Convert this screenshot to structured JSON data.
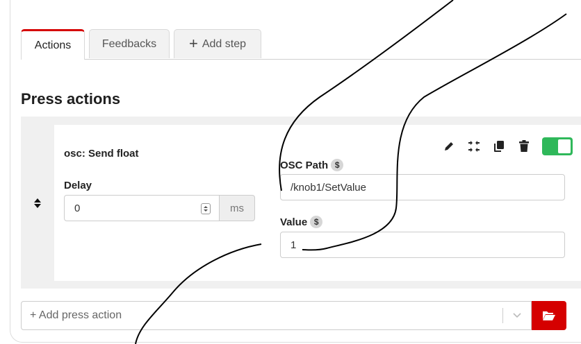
{
  "tabs": [
    {
      "label": "Actions",
      "active": true
    },
    {
      "label": "Feedbacks",
      "active": false
    },
    {
      "label": "Add step",
      "icon": "plus-icon",
      "active": false
    }
  ],
  "section": {
    "title": "Press actions"
  },
  "action": {
    "name": "osc: Send float",
    "delay": {
      "label": "Delay",
      "value": "0",
      "unit": "ms"
    },
    "osc_path": {
      "label": "OSC Path",
      "variable_badge": "$",
      "value": "/knob1/SetValue"
    },
    "value_field": {
      "label": "Value",
      "variable_badge": "$",
      "value": "1"
    },
    "toolbar_icons": [
      "pencil-icon",
      "collapse-icon",
      "copy-icon",
      "trash-icon"
    ],
    "enabled": true
  },
  "add_action": {
    "placeholder": "+ Add press action"
  },
  "colors": {
    "accent": "#d50000",
    "toggle_on": "#2fb85a",
    "section_bg": "#f0f0f0"
  }
}
